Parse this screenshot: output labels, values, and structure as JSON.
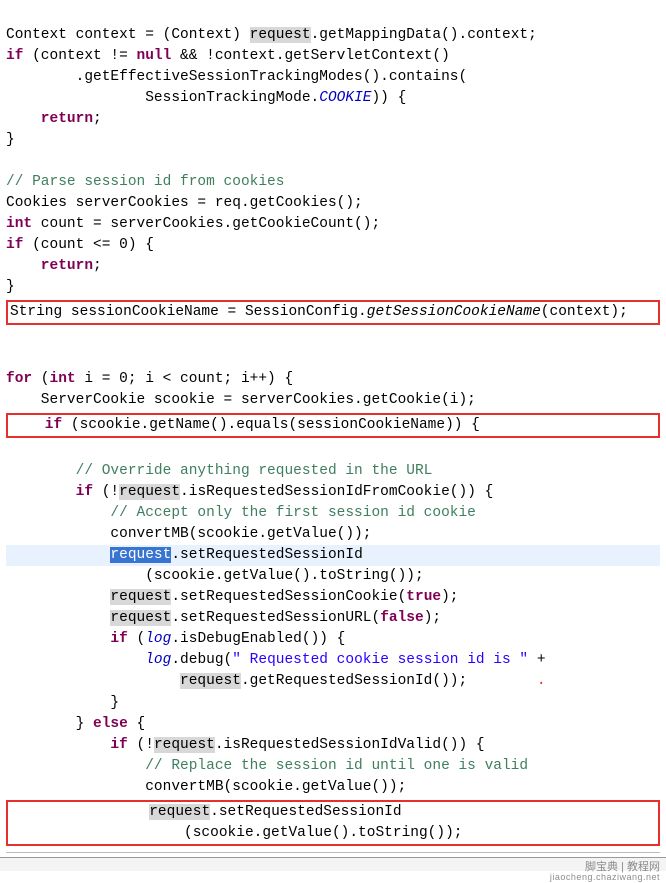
{
  "code": {
    "l1_a": "Context context = (Context) ",
    "l1_req": "request",
    "l1_b": ".getMappingData().context;",
    "l2_a": "if",
    "l2_b": " (context != ",
    "l2_null": "null",
    "l2_c": " && !context.getServletContext()",
    "l3": "        .getEffectiveSessionTrackingModes().contains(",
    "l4_a": "                SessionTrackingMode.",
    "l4_cookie": "COOKIE",
    "l4_b": ")) {",
    "l5_ret": "    return",
    "l5_semi": ";",
    "l6": "}",
    "blank": "",
    "l8_comment": "// Parse session id from cookies",
    "l9": "Cookies serverCookies = req.getCookies();",
    "l10_a": "int",
    "l10_b": " count = serverCookies.getCookieCount();",
    "l11_a": "if",
    "l11_b": " (count <= 0) {",
    "l12_ret": "    return",
    "l12_semi": ";",
    "l13": "}",
    "box1_a": "String sessionCookieName = SessionConfig.",
    "box1_call": "getSessionCookieName",
    "box1_b": "(context);",
    "l16_a": "for",
    "l16_b": " (",
    "l16_int": "int",
    "l16_c": " i = 0; i < count; i++) {",
    "l17": "    ServerCookie scookie = serverCookies.getCookie(i);",
    "box2_a": "    if",
    "box2_b": " (scookie.getName().equals(sessionCookieName)) {",
    "l19_comment": "        // Override anything requested in the URL",
    "l20_a": "        if",
    "l20_b": " (!",
    "l20_req": "request",
    "l20_c": ".isRequestedSessionIdFromCookie()) {",
    "l21_comment": "            // Accept only the first session id cookie",
    "l22": "            convertMB(scookie.getValue());",
    "l23_pad": "            ",
    "l23_req": "request",
    "l23_b": ".setRequestedSessionId",
    "l24": "                (scookie.getValue().toString());",
    "l25_pad": "            ",
    "l25_req": "request",
    "l25_b": ".setRequestedSessionCookie(",
    "l25_true": "true",
    "l25_c": ");",
    "l26_pad": "            ",
    "l26_req": "request",
    "l26_b": ".setRequestedSessionURL(",
    "l26_false": "false",
    "l26_c": ");",
    "l27_a": "            if",
    "l27_b": " (",
    "l27_log": "log",
    "l27_c": ".isDebugEnabled()) {",
    "l28_pad": "                ",
    "l28_log": "log",
    "l28_b": ".debug(",
    "l28_str": "\" Requested cookie session id is \"",
    "l28_c": " +",
    "l29_pad": "                    ",
    "l29_req": "request",
    "l29_b": ".getRequestedSessionId());",
    "l30": "            }",
    "l31_a": "        } ",
    "l31_else": "else",
    "l31_b": " {",
    "l32_a": "            if",
    "l32_b": " (!",
    "l32_req": "request",
    "l32_c": ".isRequestedSessionIdValid()) {",
    "l33_comment": "                // Replace the session id until one is valid",
    "l34": "                convertMB(scookie.getValue());",
    "box3_pad": "                ",
    "box3_req": "request",
    "box3_a": ".setRequestedSessionId",
    "box3_l2": "                    (scookie.getValue().toString());"
  },
  "watermark": {
    "line1": "脚宝典 | 教程网",
    "line2": "jiaocheng.chaziwang.net"
  }
}
